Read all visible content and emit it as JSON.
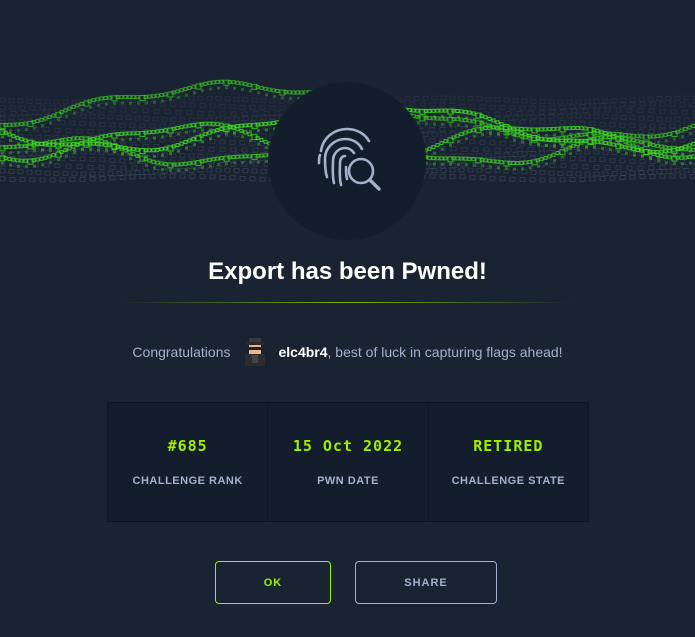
{
  "header": {
    "banner_icon": "green-cube-wave-banner",
    "emblem_icon": "fingerprint-search-icon"
  },
  "title": "Export has been Pwned!",
  "congrats": {
    "prefix": "Congratulations",
    "avatar_icon": "user-avatar",
    "username": "elc4br4",
    "suffix": ", best of luck in capturing flags ahead!"
  },
  "stats": [
    {
      "value": "#685",
      "label": "CHALLENGE RANK"
    },
    {
      "value": "15 Oct 2022",
      "label": "PWN DATE"
    },
    {
      "value": "RETIRED",
      "label": "CHALLENGE STATE"
    }
  ],
  "buttons": {
    "ok_label": "OK",
    "share_label": "SHARE"
  },
  "colors": {
    "background": "#1a2332",
    "panel": "#141d2b",
    "accent": "#9fef00",
    "muted": "#a4b1cd"
  }
}
